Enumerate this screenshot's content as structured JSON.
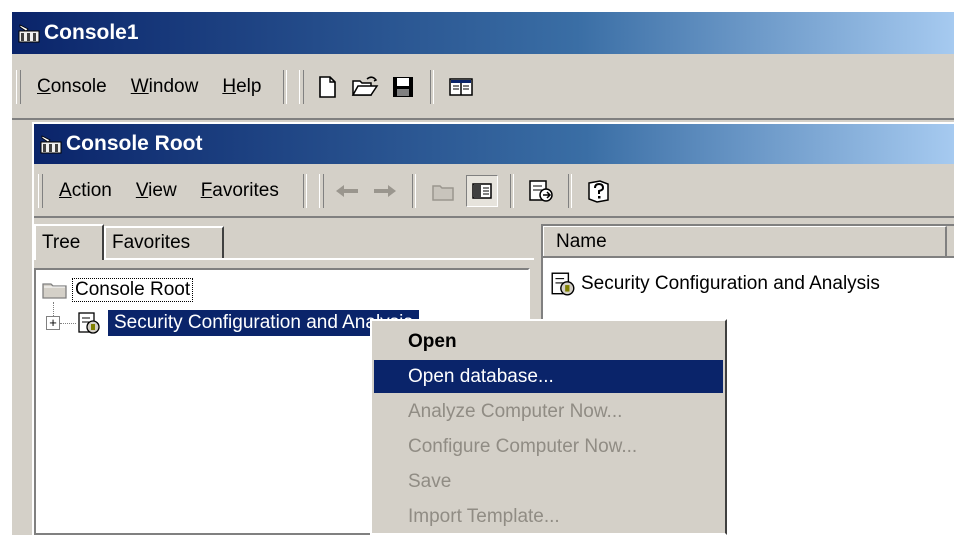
{
  "outer_window": {
    "title": "Console1",
    "menu": [
      "Console",
      "Window",
      "Help"
    ],
    "menu_mnemonic": [
      "C",
      "W",
      "H"
    ],
    "menu_rest": [
      "onsole",
      "indow",
      "elp"
    ]
  },
  "inner_window": {
    "title": "Console Root",
    "menu_mnemonic": [
      "A",
      "V",
      "F"
    ],
    "menu_rest": [
      "ction",
      "iew",
      "avorites"
    ]
  },
  "tree_pane": {
    "tabs": [
      "Tree",
      "Favorites"
    ],
    "nodes": [
      {
        "label": "Console Root"
      },
      {
        "label": "Security Configuration and Analysis",
        "expand_glyph": "+"
      }
    ]
  },
  "result_pane": {
    "column_header": "Name",
    "items": [
      "Security Configuration and Analysis"
    ]
  },
  "context_menu": {
    "items": [
      {
        "label": "Open",
        "state": "default"
      },
      {
        "label": "Open database...",
        "state": "highlighted"
      },
      {
        "label": "Analyze Computer Now...",
        "state": "disabled"
      },
      {
        "label": "Configure Computer Now...",
        "state": "disabled"
      },
      {
        "label": "Save",
        "state": "disabled"
      },
      {
        "label": "Import Template...",
        "state": "disabled"
      }
    ]
  },
  "colors": {
    "title_active": "#0a246a",
    "selection": "#0a246a",
    "face": "#d4d0c8",
    "disabled_text": "#908c84"
  }
}
